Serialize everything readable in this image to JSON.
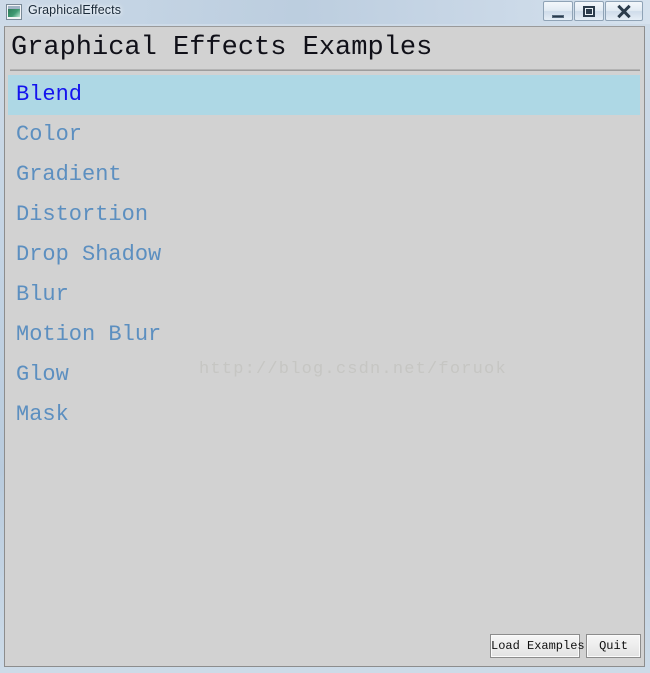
{
  "window": {
    "title": "GraphicalEffects",
    "icon": "application-window-icon",
    "controls": {
      "minimize": "minimize-icon",
      "maximize": "restore-icon",
      "close": "close-icon"
    }
  },
  "content": {
    "heading": "Graphical Effects Examples",
    "watermark": "http://blog.csdn.net/foruok",
    "effects": [
      {
        "label": "Blend",
        "selected": true
      },
      {
        "label": "Color",
        "selected": false
      },
      {
        "label": "Gradient",
        "selected": false
      },
      {
        "label": "Distortion",
        "selected": false
      },
      {
        "label": "Drop Shadow",
        "selected": false
      },
      {
        "label": "Blur",
        "selected": false
      },
      {
        "label": "Motion Blur",
        "selected": false
      },
      {
        "label": "Glow",
        "selected": false
      },
      {
        "label": "Mask",
        "selected": false
      }
    ]
  },
  "buttons": {
    "load_examples": "Load Examples",
    "quit": "Quit"
  },
  "colors": {
    "selected_background": "#aed8e5",
    "selected_text": "#1414ee",
    "item_text": "#5c8fc0",
    "client_background": "#d2d2d2",
    "heading_text": "#101018",
    "watermark_text": "#c6c6c3"
  }
}
